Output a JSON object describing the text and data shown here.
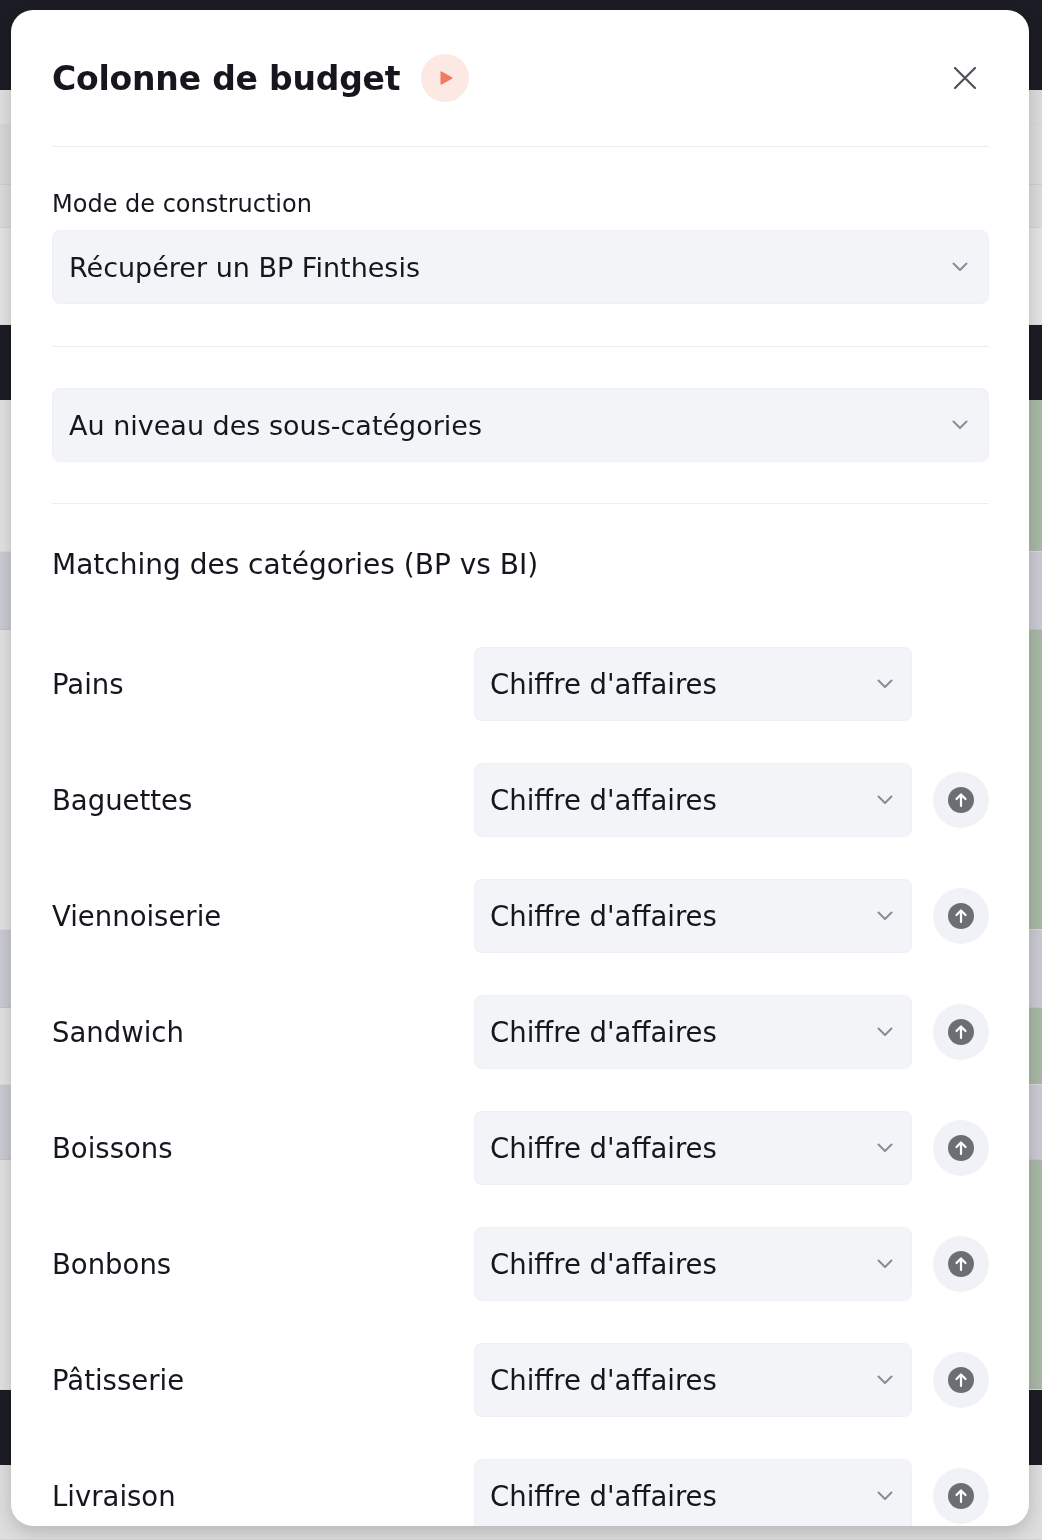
{
  "dialog": {
    "title": "Colonne de budget"
  },
  "construction_mode": {
    "label": "Mode de construction",
    "value": "Récupérer un BP Finthesis"
  },
  "level_select": {
    "value": "Au niveau des sous-catégories"
  },
  "matching": {
    "heading": "Matching des catégories (BP vs BI)",
    "rows": [
      {
        "category": "Pains",
        "value": "Chiffre d'affaires",
        "move_up": false
      },
      {
        "category": "Baguettes",
        "value": "Chiffre d'affaires",
        "move_up": true
      },
      {
        "category": "Viennoiserie",
        "value": "Chiffre d'affaires",
        "move_up": true
      },
      {
        "category": "Sandwich",
        "value": "Chiffre d'affaires",
        "move_up": true
      },
      {
        "category": "Boissons",
        "value": "Chiffre d'affaires",
        "move_up": true
      },
      {
        "category": "Bonbons",
        "value": "Chiffre d'affaires",
        "move_up": true
      },
      {
        "category": "Pâtisserie",
        "value": "Chiffre d'affaires",
        "move_up": true
      },
      {
        "category": "Livraison",
        "value": "Chiffre d'affaires",
        "move_up": true
      }
    ]
  }
}
